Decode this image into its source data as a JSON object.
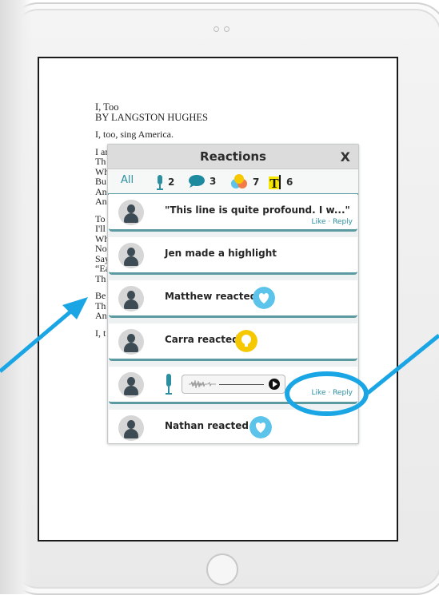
{
  "poem": {
    "title": "I, Too",
    "author": "BY LANGSTON HUGHES",
    "lines_stanza1": [
      "I, too, sing America."
    ],
    "lines_stanza2": [
      "I am",
      "Th",
      "Wh",
      "Bu",
      "An",
      "An"
    ],
    "lines_stanza3": [
      "To",
      "I'll",
      "Wh",
      "No",
      "Say",
      "“Ea",
      "Th"
    ],
    "lines_stanza4": [
      "Be",
      "Th",
      "An"
    ],
    "lines_stanza5": [
      "I, t"
    ]
  },
  "reactions_panel": {
    "title": "Reactions",
    "close_label": "X",
    "filters": {
      "all_label": "All",
      "audio_count": "2",
      "comment_count": "3",
      "reaction_count": "7",
      "highlight_count": "6"
    },
    "items": [
      {
        "text": "\"This line is quite profound. I w...\"",
        "actions": "Like · Reply"
      },
      {
        "text": "Jen made a highlight"
      },
      {
        "text": "Matthew reacted",
        "reaction": "heart"
      },
      {
        "text": "Carra reacted",
        "reaction": "lightbulb"
      },
      {
        "actions": "Like · Reply",
        "type": "audio"
      },
      {
        "text": "Nathan reacted",
        "reaction": "heart"
      }
    ]
  },
  "colors": {
    "accent_teal": "#2b8fa0",
    "callout_blue": "#1aa6e4",
    "heart_blue": "#5cc3ea",
    "bulb_yellow": "#f5c800"
  }
}
